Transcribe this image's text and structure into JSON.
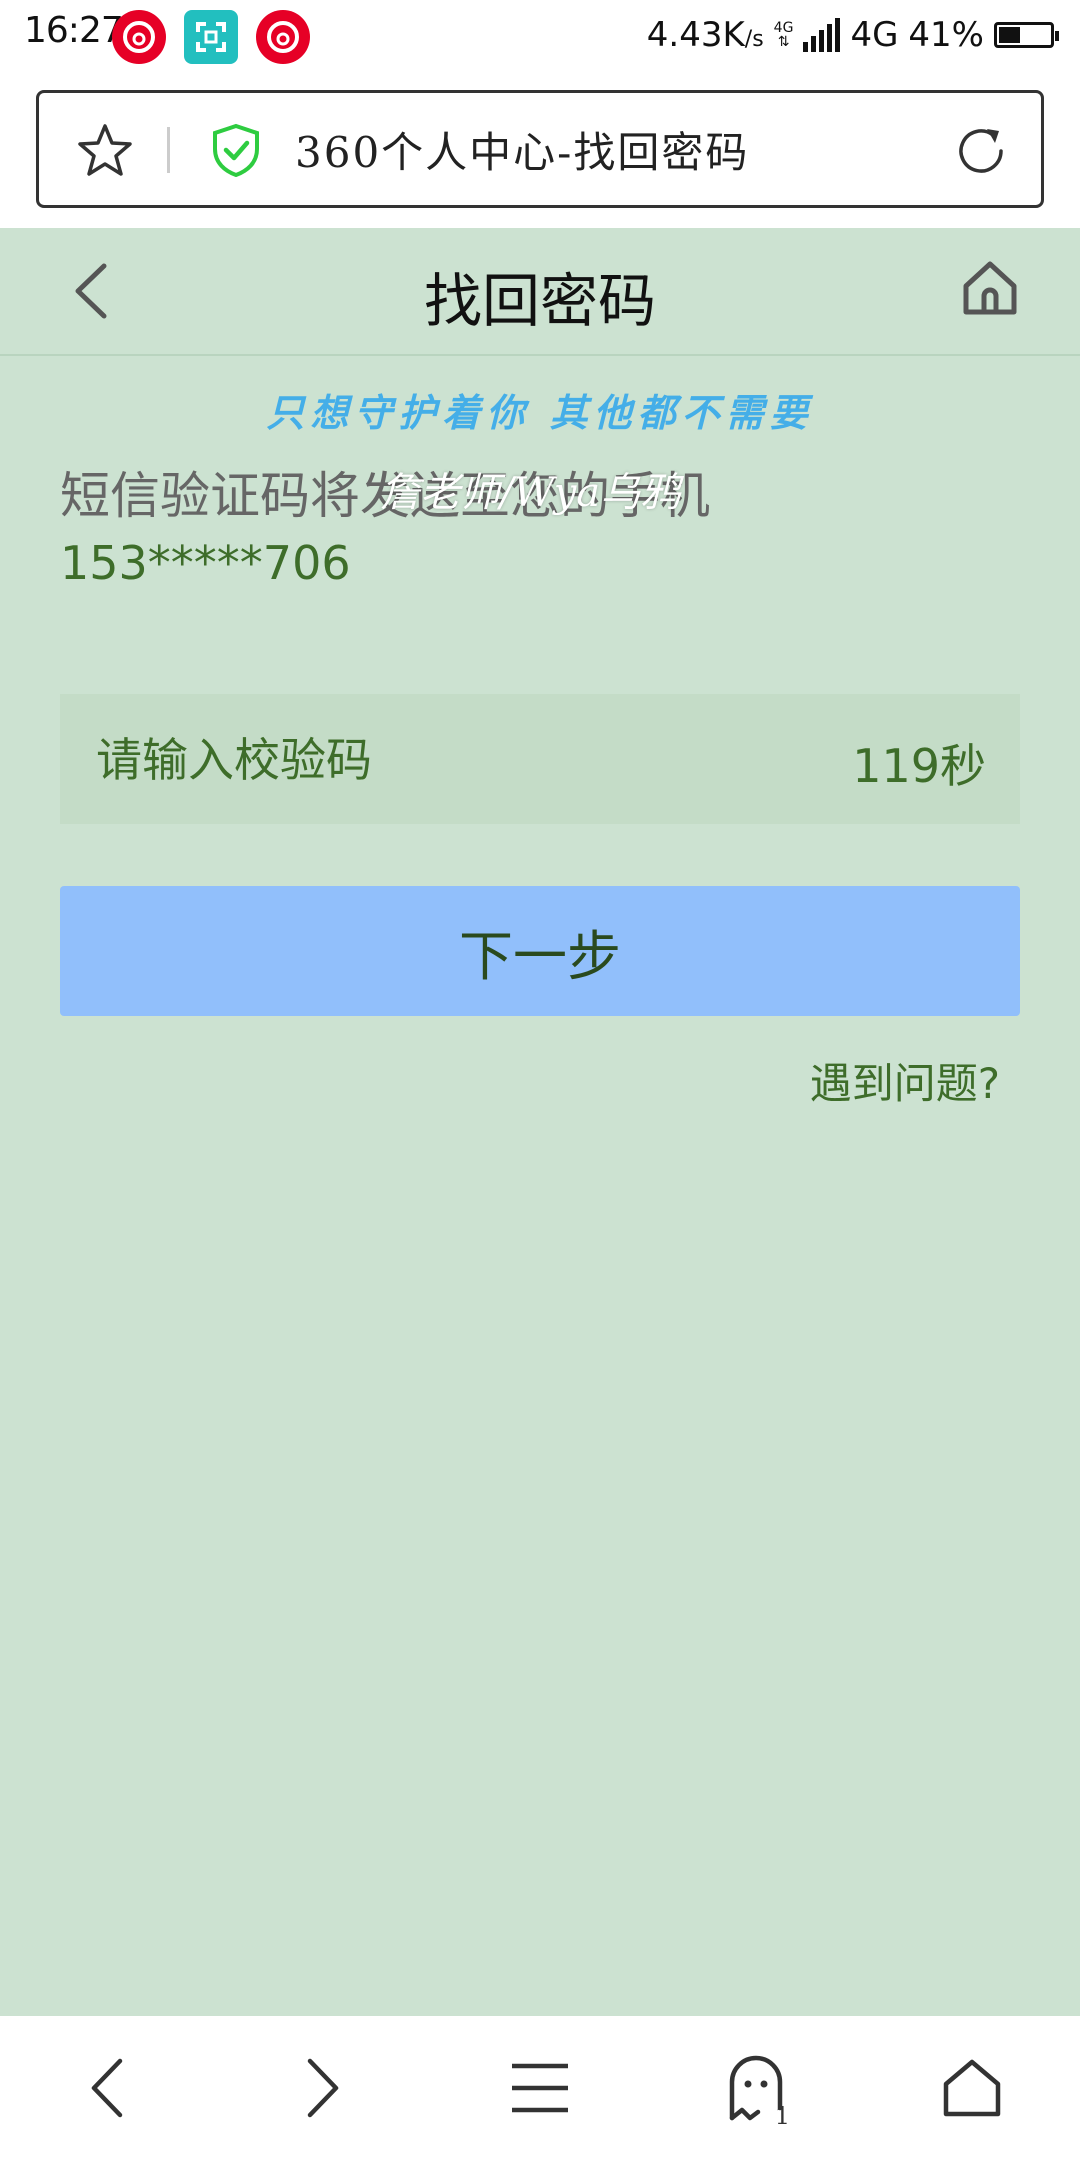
{
  "status_bar": {
    "time": "16:27",
    "net_speed_value": "4.43K",
    "net_speed_unit": "/s",
    "small_network": "4G",
    "network": "4G",
    "battery_percent": "41%",
    "battery_level": 0.41
  },
  "address_bar": {
    "page_url": "360个人中心-找回密码"
  },
  "header": {
    "title": "找回密码"
  },
  "watermark": {
    "line": "只想守护着你 其他都不需要",
    "signature": "詹老师/Wya乌鸦"
  },
  "content": {
    "sms_notice": "短信验证码将发送至您的手机",
    "phone_number": "153*****706",
    "code_placeholder": "请输入校验码",
    "countdown": "119秒",
    "next_label": "下一步",
    "help_label": "遇到问题?"
  },
  "bottom_nav": {
    "tab_count": "1"
  },
  "colors": {
    "page_bg": "#cce2d1",
    "text_green": "#3e6d2a",
    "button_blue": "#91bffb",
    "watermark_blue": "#44aee8"
  }
}
